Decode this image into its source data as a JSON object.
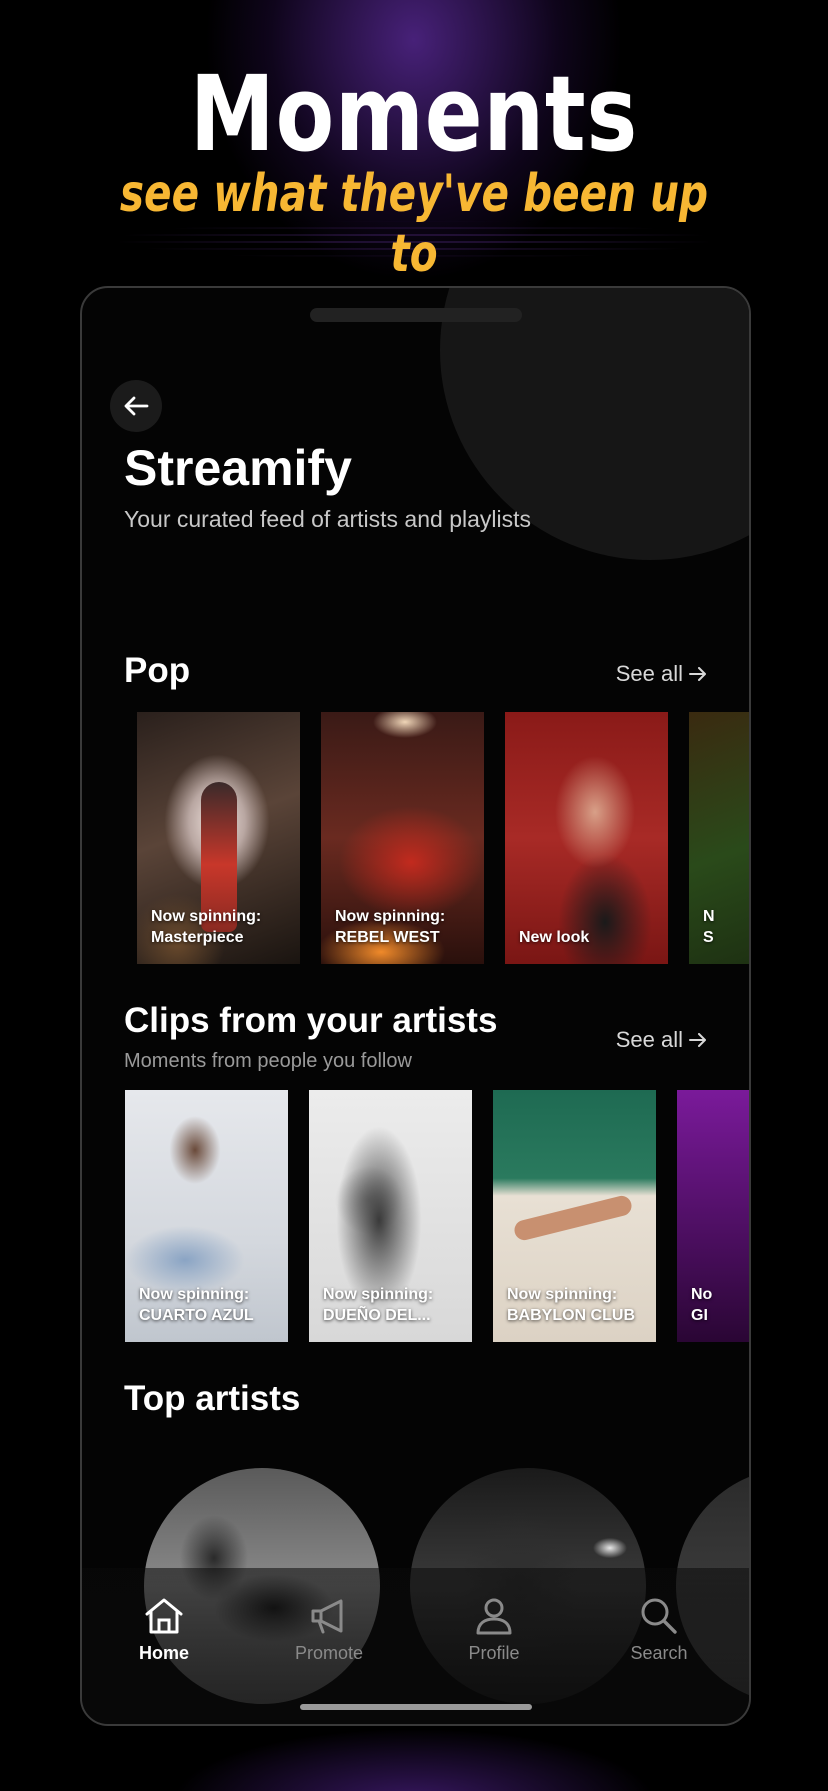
{
  "promo": {
    "title": "Moments",
    "subtitle": "see what they've been up to"
  },
  "header": {
    "title": "Streamify",
    "subtitle": "Your curated feed of artists and playlists"
  },
  "pop": {
    "title": "Pop",
    "see_all": "See all",
    "cards": [
      {
        "caption_line1": "Now spinning:",
        "caption_line2": "Masterpiece"
      },
      {
        "caption_line1": "Now spinning:",
        "caption_line2": "REBEL WEST"
      },
      {
        "caption_line1": "New look",
        "caption_line2": ""
      },
      {
        "caption_line1": "N",
        "caption_line2": "S"
      }
    ]
  },
  "clips": {
    "title": "Clips from your artists",
    "subtitle": "Moments from people you follow",
    "see_all": "See all",
    "cards": [
      {
        "caption_line1": "Now spinning:",
        "caption_line2": "CUARTO AZUL"
      },
      {
        "caption_line1": "Now spinning:",
        "caption_line2": "DUEÑO DEL..."
      },
      {
        "caption_line1": "Now spinning:",
        "caption_line2": "BABYLON CLUB"
      },
      {
        "caption_line1": "No",
        "caption_line2": "GI"
      }
    ]
  },
  "top_artists": {
    "title": "Top artists"
  },
  "nav": {
    "home": "Home",
    "promote": "Promote",
    "profile": "Profile",
    "search": "Search",
    "active": "home"
  },
  "colors": {
    "accent_yellow": "#f7b733",
    "glow_purple": "#823cdc",
    "background": "#000000"
  }
}
